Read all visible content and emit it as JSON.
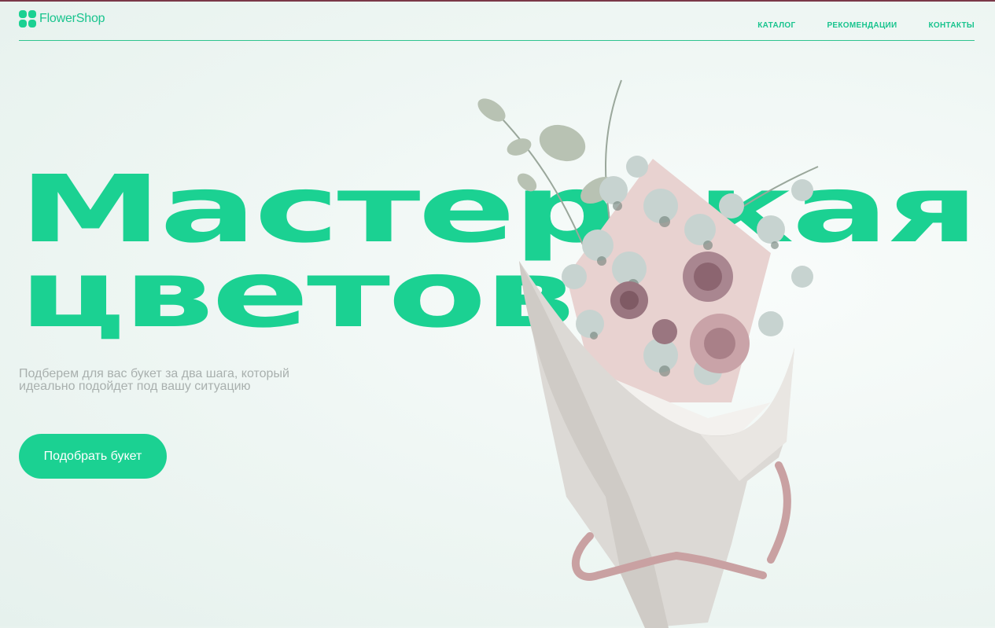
{
  "brand": {
    "name": "FlowerShop"
  },
  "nav": {
    "items": [
      {
        "label": "КАТАЛОГ"
      },
      {
        "label": "РЕКОМЕНДАЦИИ"
      },
      {
        "label": "КОНТАКТЫ"
      }
    ]
  },
  "hero": {
    "title_line1": "Мастерская",
    "title_line2": "цветов",
    "subtitle": "Подберем для вас букет за два шага, который идеально подойдет под вашу ситуацию",
    "cta_label": "Подобрать букет"
  },
  "colors": {
    "accent": "#1bd192",
    "background": "#eef6f3",
    "subtitle": "#a9b0ae"
  }
}
